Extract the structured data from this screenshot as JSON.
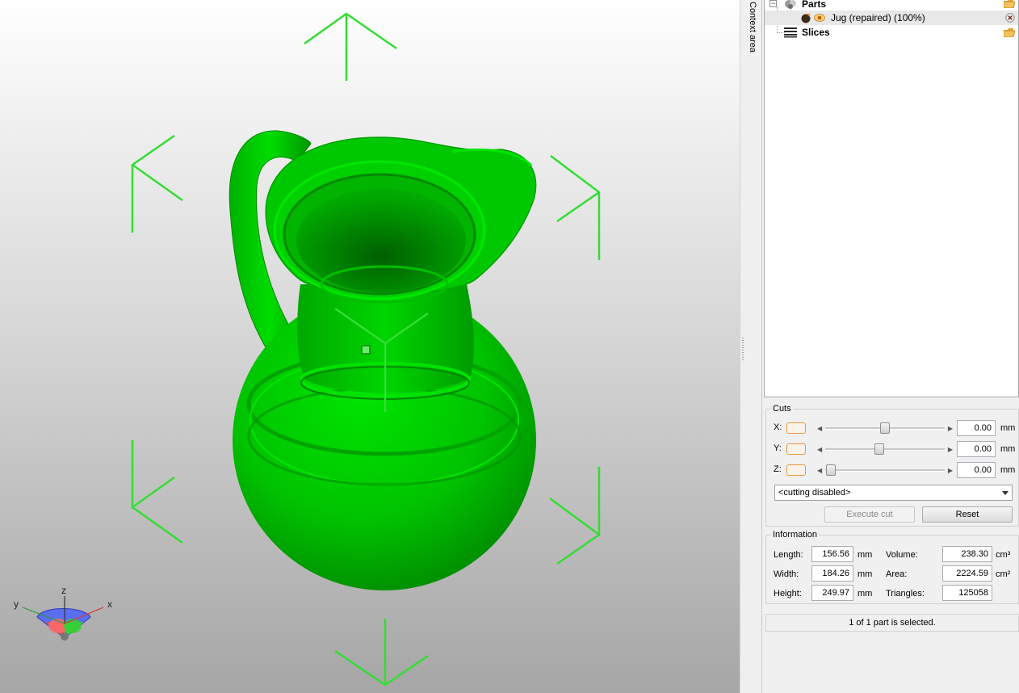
{
  "context_tab": {
    "label": "Context area"
  },
  "tree": {
    "parts_label": "Parts",
    "part_item": "Jug (repaired) (100%)",
    "slices_label": "Slices"
  },
  "cuts": {
    "title": "Cuts",
    "rows": [
      {
        "axis": "X:",
        "value": "0.00",
        "unit": "mm",
        "slider_fraction": 0.5
      },
      {
        "axis": "Y:",
        "value": "0.00",
        "unit": "mm",
        "slider_fraction": 0.45
      },
      {
        "axis": "Z:",
        "value": "0.00",
        "unit": "mm",
        "slider_fraction": 0.05
      }
    ],
    "mode_selected": "<cutting disabled>",
    "execute_label": "Execute cut",
    "reset_label": "Reset"
  },
  "information": {
    "title": "Information",
    "length_label": "Length:",
    "length_value": "156.56",
    "length_unit": "mm",
    "width_label": "Width:",
    "width_value": "184.26",
    "width_unit": "mm",
    "height_label": "Height:",
    "height_value": "249.97",
    "height_unit": "mm",
    "volume_label": "Volume:",
    "volume_value": "238.30",
    "volume_unit": "cm³",
    "area_label": "Area:",
    "area_value": "2224.59",
    "area_unit": "cm²",
    "triangles_label": "Triangles:",
    "triangles_value": "125058"
  },
  "status_text": "1 of 1 part is selected.",
  "axis_gizmo": {
    "x_label": "x",
    "y_label": "y",
    "z_label": "z"
  },
  "colors": {
    "model_green": "#00cc00",
    "handle_green": "#33dd33",
    "toggle_orange": "#e2983e"
  },
  "icons": [
    "parts-icon",
    "visibility-eye-icon",
    "slices-icon",
    "open-folder-icon",
    "remove-icon"
  ]
}
